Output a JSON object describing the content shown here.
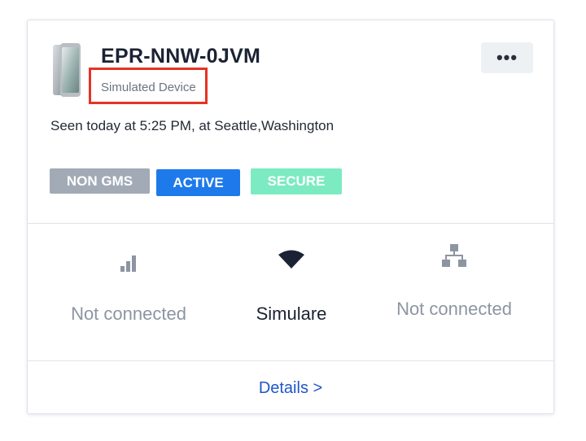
{
  "device": {
    "name": "EPR-NNW-0JVM",
    "type_label": "Simulated Device",
    "seen_text": "Seen today at 5:25 PM, at Seattle,Washington",
    "more_label": "•••"
  },
  "badges": [
    {
      "label": "NON GMS",
      "color": "#a2aab6"
    },
    {
      "label": "ACTIVE",
      "color": "#1e7aeb"
    },
    {
      "label": "SECURE",
      "color": "#7cebc1"
    }
  ],
  "connectivity": [
    {
      "icon": "cellular-signal-icon",
      "label": "Not connected"
    },
    {
      "icon": "wifi-icon",
      "label": "Simulare"
    },
    {
      "icon": "network-icon",
      "label": "Not connected"
    }
  ],
  "footer": {
    "details_label": "Details >"
  },
  "colors": {
    "highlight_box": "#e63323",
    "link": "#1f56c9",
    "muted": "#8d95a2"
  }
}
